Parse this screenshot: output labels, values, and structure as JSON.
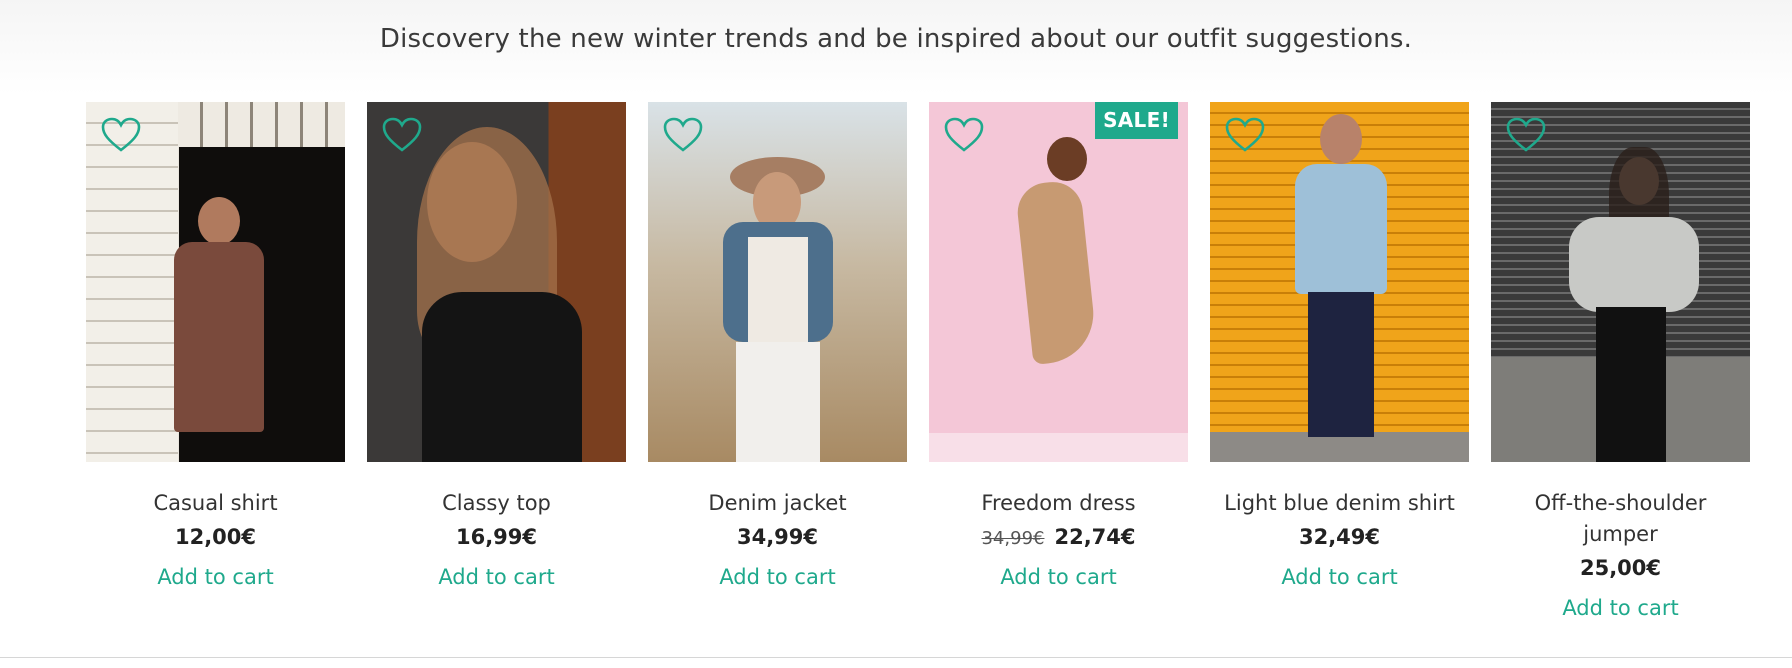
{
  "intro": "Discovery the new winter trends and be inspired about our outfit suggestions.",
  "accent_color": "#1fa98c",
  "products": [
    {
      "name": "Casual shirt",
      "price": "12,00€",
      "old_price": "",
      "sale_badge": "",
      "cart_label": "Add to cart",
      "favorite_icon": "heart-outline-icon"
    },
    {
      "name": "Classy top",
      "price": "16,99€",
      "old_price": "",
      "sale_badge": "",
      "cart_label": "Add to cart",
      "favorite_icon": "heart-outline-icon"
    },
    {
      "name": "Denim jacket",
      "price": "34,99€",
      "old_price": "",
      "sale_badge": "",
      "cart_label": "Add to cart",
      "favorite_icon": "heart-outline-icon"
    },
    {
      "name": "Freedom dress",
      "price": "22,74€",
      "old_price": "34,99€",
      "sale_badge": "SALE!",
      "cart_label": "Add to cart",
      "favorite_icon": "heart-outline-icon"
    },
    {
      "name": "Light blue denim shirt",
      "price": "32,49€",
      "old_price": "",
      "sale_badge": "",
      "cart_label": "Add to cart",
      "favorite_icon": "heart-outline-icon"
    },
    {
      "name": "Off-the-shoulder jumper",
      "price": "25,00€",
      "old_price": "",
      "sale_badge": "",
      "cart_label": "Add to cart",
      "favorite_icon": "heart-outline-icon"
    }
  ]
}
